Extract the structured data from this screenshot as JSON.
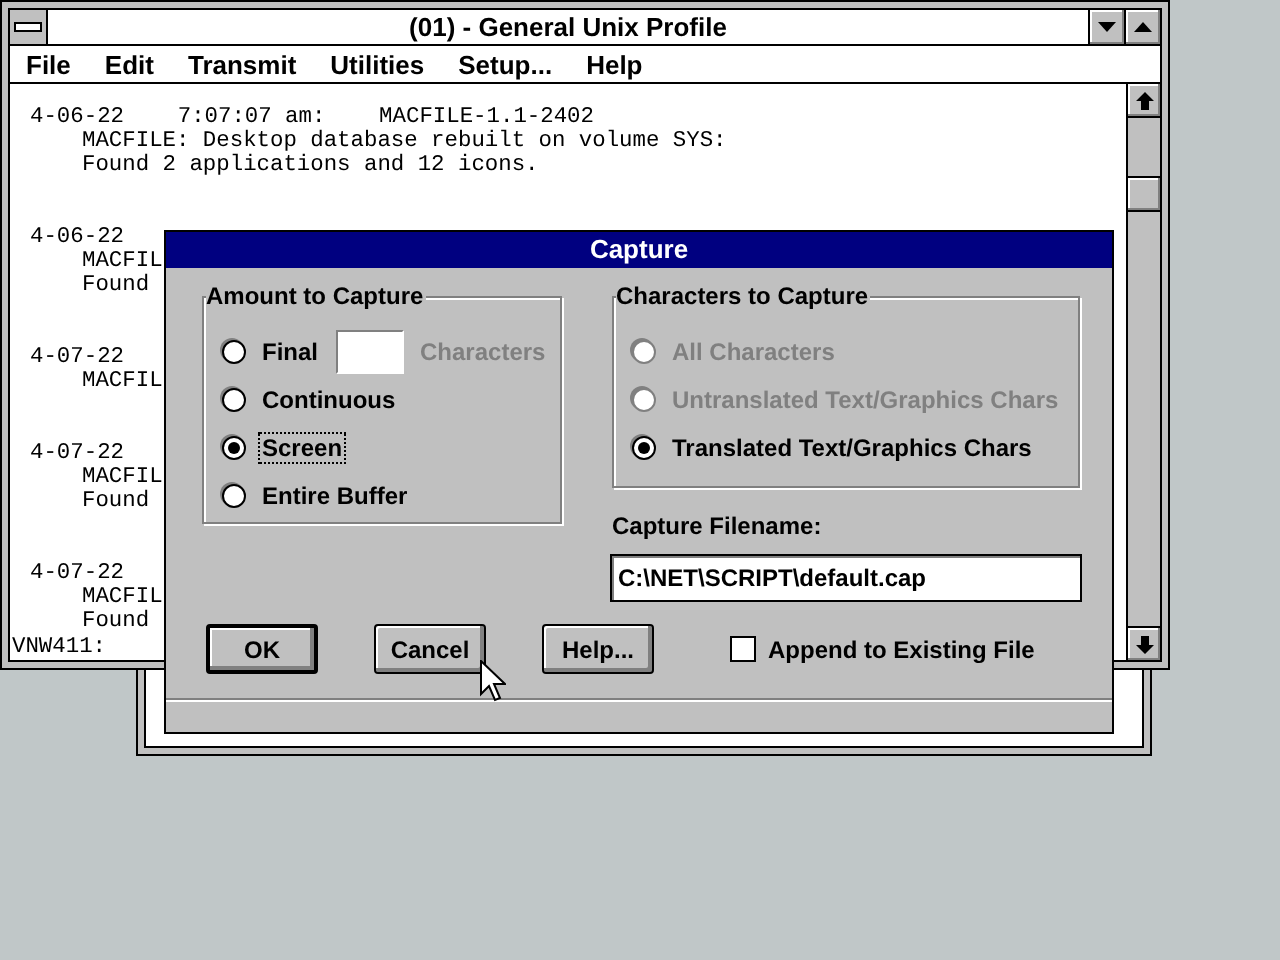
{
  "window": {
    "title": "(01) - General Unix Profile",
    "menu": [
      "File",
      "Edit",
      "Transmit",
      "Utilities",
      "Setup...",
      "Help"
    ]
  },
  "terminal": {
    "entries": [
      {
        "header": "4-06-22    7:07:07 am:    MACFILE-1.1-2402",
        "lines": [
          "MACFILE: Desktop database rebuilt on volume SYS:",
          "Found 2 applications and 12 icons."
        ]
      },
      {
        "header": "4-06-22",
        "lines": [
          "MACFIL",
          "Found"
        ]
      },
      {
        "header": "4-07-22",
        "lines": [
          "MACFIL"
        ]
      },
      {
        "header": "4-07-22",
        "lines": [
          "MACFIL",
          "Found"
        ]
      },
      {
        "header": "4-07-22",
        "lines": [
          "MACFIL",
          "Found"
        ]
      }
    ],
    "prompt": "VNW411:"
  },
  "dialog": {
    "title": "Capture",
    "amount": {
      "label": "Amount to Capture",
      "options": [
        {
          "label": "Final",
          "selected": false,
          "focused": false,
          "kind": "count"
        },
        {
          "label": "Continuous",
          "selected": false,
          "focused": false,
          "kind": "plain"
        },
        {
          "label": "Screen",
          "selected": true,
          "focused": true,
          "kind": "plain"
        },
        {
          "label": "Entire Buffer",
          "selected": false,
          "focused": false,
          "kind": "plain"
        }
      ],
      "count_unit": {
        "label": "Characters",
        "disabled": true
      }
    },
    "characters": {
      "label": "Characters to Capture",
      "options": [
        {
          "label": "All Characters",
          "selected": false,
          "disabled": true
        },
        {
          "label": "Untranslated Text/Graphics Chars",
          "selected": false,
          "disabled": true
        },
        {
          "label": "Translated Text/Graphics Chars",
          "selected": true,
          "disabled": false
        }
      ]
    },
    "filename": {
      "label": "Capture Filename:",
      "value": "C:\\NET\\SCRIPT\\default.cap"
    },
    "buttons": [
      {
        "label": "OK",
        "default": true
      },
      {
        "label": "Cancel",
        "default": false
      },
      {
        "label": "Help...",
        "default": false
      }
    ],
    "append": {
      "label": "Append to Existing File",
      "checked": false
    }
  }
}
